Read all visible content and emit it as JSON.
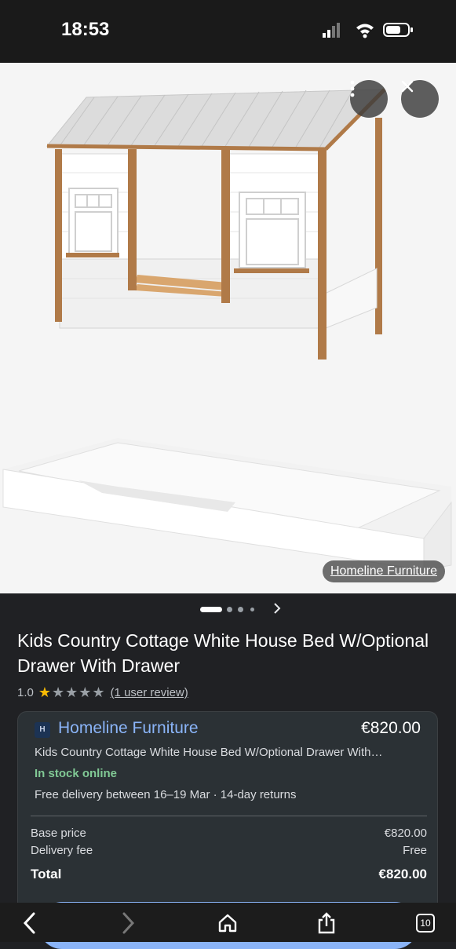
{
  "status_bar": {
    "time": "18:53"
  },
  "image_viewer": {
    "source_label": "Homeline Furniture",
    "pager": {
      "total_dots": 4,
      "active_index": 0
    }
  },
  "product": {
    "title": "Kids Country Cottage White House Bed W/Optional Drawer With Drawer",
    "rating_value": "1.0",
    "stars_filled": 1,
    "stars_total": 5,
    "review_link": "(1 user review)"
  },
  "offer": {
    "merchant_logo_text": "H",
    "merchant_name": "Homeline Furniture",
    "price": "€820.00",
    "product_line": "Kids Country Cottage White House Bed W/Optional Drawer With…",
    "stock_status": "In stock online",
    "delivery_text": "Free delivery between 16–19 Mar · 14-day returns",
    "breakdown": {
      "base_price_label": "Base price",
      "base_price_value": "€820.00",
      "delivery_fee_label": "Delivery fee",
      "delivery_fee_value": "Free",
      "total_label": "Total",
      "total_value": "€820.00"
    }
  },
  "browser_toolbar": {
    "tab_count": "10"
  },
  "colors": {
    "background": "#202124",
    "link_blue": "#8ab4f8",
    "stock_green": "#81c995",
    "star_yellow": "#fbbc04"
  }
}
